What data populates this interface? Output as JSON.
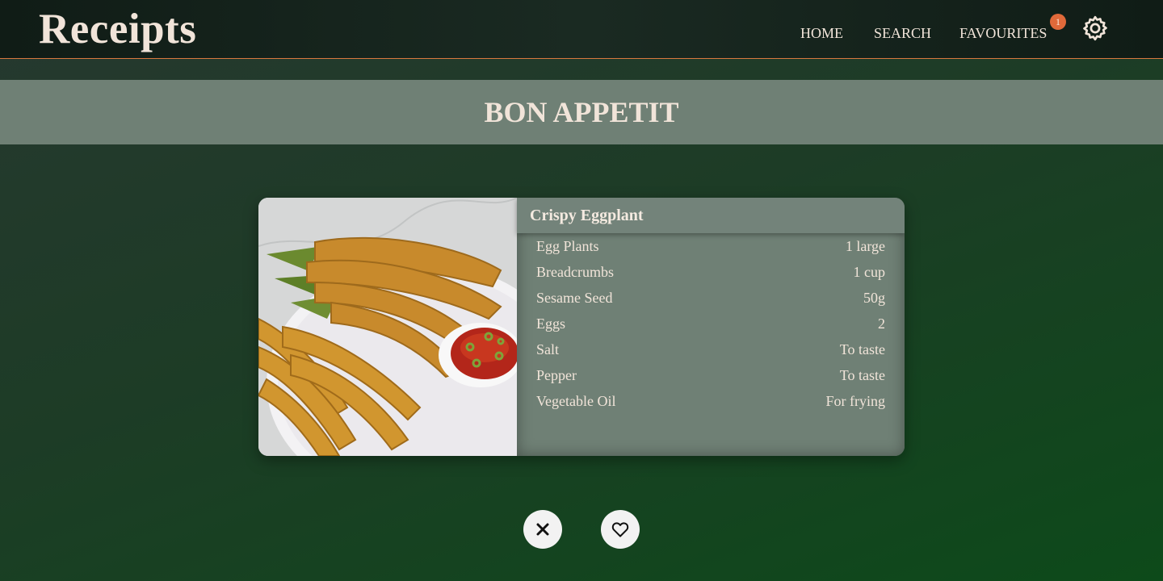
{
  "header": {
    "logo": "Receipts",
    "nav": {
      "home": "HOME",
      "search": "SEARCH",
      "favourites": "FAVOURITES"
    },
    "favourites_count": "1",
    "settings_icon": "gear-icon"
  },
  "banner": {
    "title": "BON APPETIT"
  },
  "recipe": {
    "title": "Crispy Eggplant",
    "image": "fried-eggplant-photo",
    "ingredients": [
      {
        "name": "Egg Plants",
        "qty": "1 large"
      },
      {
        "name": "Breadcrumbs",
        "qty": "1 cup"
      },
      {
        "name": "Sesame Seed",
        "qty": "50g"
      },
      {
        "name": "Eggs",
        "qty": "2"
      },
      {
        "name": "Salt",
        "qty": "To taste"
      },
      {
        "name": "Pepper",
        "qty": "To taste"
      },
      {
        "name": "Vegetable Oil",
        "qty": "For frying"
      }
    ]
  },
  "actions": {
    "dismiss_icon": "close-icon",
    "favourite_icon": "heart-icon"
  },
  "colors": {
    "accent": "#e0693a",
    "panel": "#6f8075",
    "text": "#f1e4d9"
  }
}
